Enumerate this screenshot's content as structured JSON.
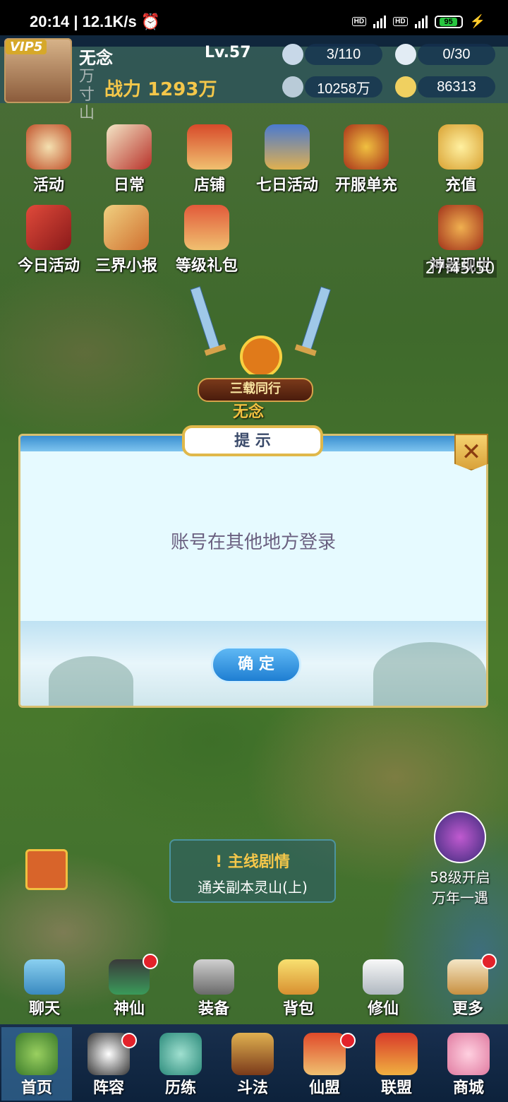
{
  "status_bar": {
    "time": "20:14",
    "speed": "12.1K/s",
    "battery": "95"
  },
  "player": {
    "vip": "VIP5",
    "name": "无念",
    "level": "Lv.57",
    "power_label": "战力",
    "power_value": "1293万",
    "location": "万寸山"
  },
  "resources": {
    "stamina": "3/110",
    "energy": "0/30",
    "gold": "10258万",
    "ingots": "86313"
  },
  "activities_row1": [
    "活动",
    "日常",
    "店铺",
    "七日活动",
    "开服单充",
    "充值"
  ],
  "activities_row2": [
    "今日活动",
    "三界小报",
    "等级礼包",
    "神器现世"
  ],
  "event_timer": "27:45:50",
  "player_title": "三载同行",
  "player_name_map": "无念",
  "dialog": {
    "title": "提 示",
    "message": "账号在其他地方登录",
    "confirm": "确 定"
  },
  "quest": {
    "title": "主线剧情",
    "desc": "通关副本灵山(上)"
  },
  "level_event": {
    "line1": "58级开启",
    "line2": "万年一遇"
  },
  "functions": [
    "聊天",
    "神仙",
    "装备",
    "背包",
    "修仙",
    "更多"
  ],
  "nav": [
    "首页",
    "阵容",
    "历练",
    "斗法",
    "仙盟",
    "联盟",
    "商城"
  ]
}
